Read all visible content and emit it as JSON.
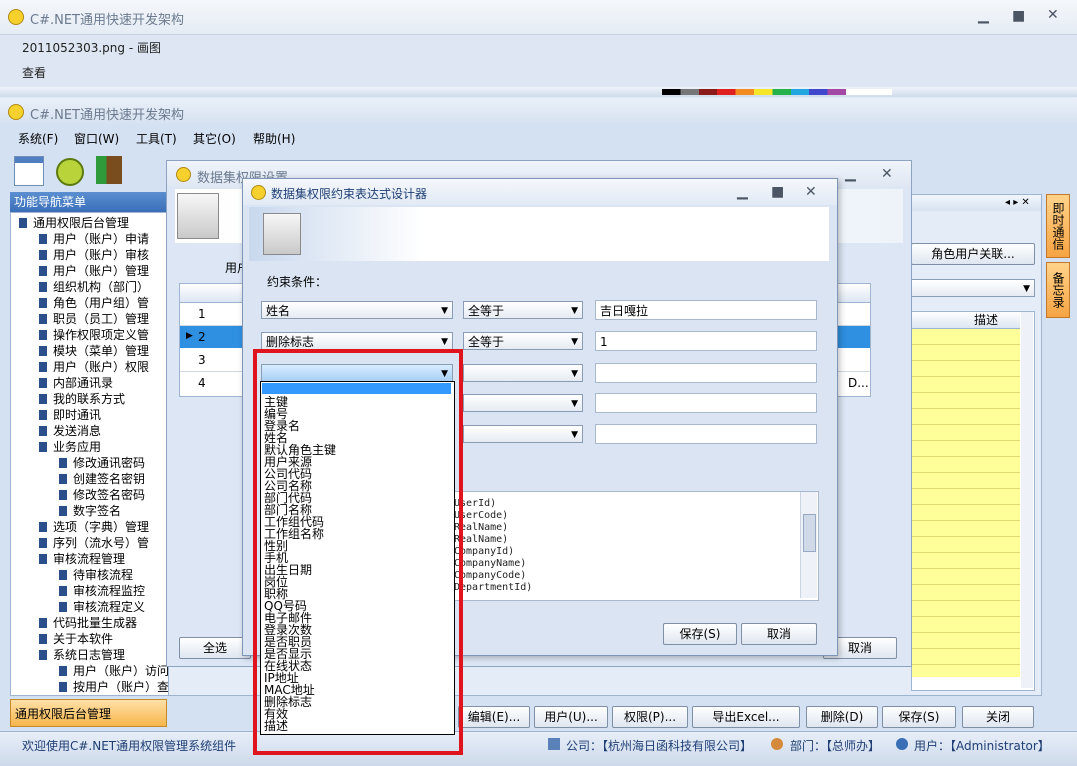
{
  "outer_window": {
    "title": "C#.NET通用快速开发架构"
  },
  "paint_window": {
    "title": "2011052303.png - 画图",
    "menu_item": "查看"
  },
  "main_window": {
    "title": "C#.NET通用快速开发架构",
    "menu": [
      "系统(F)",
      "窗口(W)",
      "工具(T)",
      "其它(O)",
      "帮助(H)"
    ]
  },
  "nav": {
    "header": "功能导航菜单",
    "items": [
      {
        "label": "通用权限后台管理",
        "level": 0
      },
      {
        "label": "用户（账户）申请",
        "level": 1
      },
      {
        "label": "用户（账户）审核",
        "level": 1
      },
      {
        "label": "用户（账户）管理",
        "level": 1
      },
      {
        "label": "组织机构（部门）",
        "level": 1
      },
      {
        "label": "角色（用户组）管",
        "level": 1
      },
      {
        "label": "职员（员工）管理",
        "level": 1
      },
      {
        "label": "操作权限项定义管",
        "level": 1
      },
      {
        "label": "模块（菜单）管理",
        "level": 1
      },
      {
        "label": "用户（账户）权限",
        "level": 1
      },
      {
        "label": "内部通讯录",
        "level": 1
      },
      {
        "label": "我的联系方式",
        "level": 1
      },
      {
        "label": "即时通讯",
        "level": 1
      },
      {
        "label": "发送消息",
        "level": 1
      },
      {
        "label": "业务应用",
        "level": 1
      },
      {
        "label": "修改通讯密码",
        "level": 2
      },
      {
        "label": "创建签名密钥",
        "level": 2
      },
      {
        "label": "修改签名密码",
        "level": 2
      },
      {
        "label": "数字签名",
        "level": 2
      },
      {
        "label": "选项（字典）管理",
        "level": 1
      },
      {
        "label": "序列（流水号）管",
        "level": 1
      },
      {
        "label": "审核流程管理",
        "level": 1
      },
      {
        "label": "待审核流程",
        "level": 2
      },
      {
        "label": "审核流程监控",
        "level": 2
      },
      {
        "label": "审核流程定义",
        "level": 2
      },
      {
        "label": "代码批量生成器",
        "level": 1
      },
      {
        "label": "关于本软件",
        "level": 1
      },
      {
        "label": "系统日志管理",
        "level": 1
      },
      {
        "label": "用户（账户）访问情况",
        "level": 2
      },
      {
        "label": "按用户（账户）查询",
        "level": 2
      }
    ],
    "bottom_tab": "通用权限后台管理"
  },
  "side_tabs": [
    "即时通信",
    "备忘录"
  ],
  "bg_dialog": {
    "title": "数据集权限设置",
    "user_label": "用户",
    "row_numbers": [
      "1",
      "2",
      "3",
      "4"
    ],
    "select_all": "全选",
    "cancel": "取消",
    "role_user_button": "角色用户关联...",
    "desc_header": "描述",
    "row4_tail": "D..."
  },
  "dialog": {
    "title": "数据集权限约束表达式设计器",
    "condition_label": "约束条件：",
    "rows": [
      {
        "field": "姓名",
        "op": "全等于",
        "value": "吉日嘎拉"
      },
      {
        "field": "删除标志",
        "op": "全等于",
        "value": "1"
      },
      {
        "field": "",
        "op": "",
        "value": ""
      },
      {
        "field": "",
        "op": "",
        "value": ""
      },
      {
        "field": "",
        "op": "",
        "value": ""
      }
    ],
    "code_lines": [
      "UserId)",
      "UserCode)",
      "RealName)",
      "RealName)",
      "CompanyId)",
      "CompanyName)",
      "CompanyCode)",
      "DepartmentId)"
    ],
    "save": "保存(S)",
    "cancel": "取消"
  },
  "dropdown_options": [
    "主键",
    "编号",
    "登录名",
    "姓名",
    "默认角色主键",
    "用户来源",
    "公司代码",
    "公司名称",
    "部门代码",
    "部门名称",
    "工作组代码",
    "工作组名称",
    "性别",
    "手机",
    "出生日期",
    "岗位",
    "职称",
    "QQ号码",
    "电子邮件",
    "登录次数",
    "是否职员",
    "是否显示",
    "在线状态",
    "IP地址",
    "MAC地址",
    "删除标志",
    "有效",
    "描述"
  ],
  "toolbar": [
    "编辑(E)...",
    "用户(U)...",
    "权限(P)...",
    "导出Excel...",
    "删除(D)",
    "保存(S)",
    "关闭"
  ],
  "status": {
    "welcome": "欢迎使用C#.NET通用权限管理系统组件",
    "company": "公司：【杭州海日函科技有限公司】",
    "department": "部门：【总师办】",
    "user": "用户：【Administrator】"
  }
}
